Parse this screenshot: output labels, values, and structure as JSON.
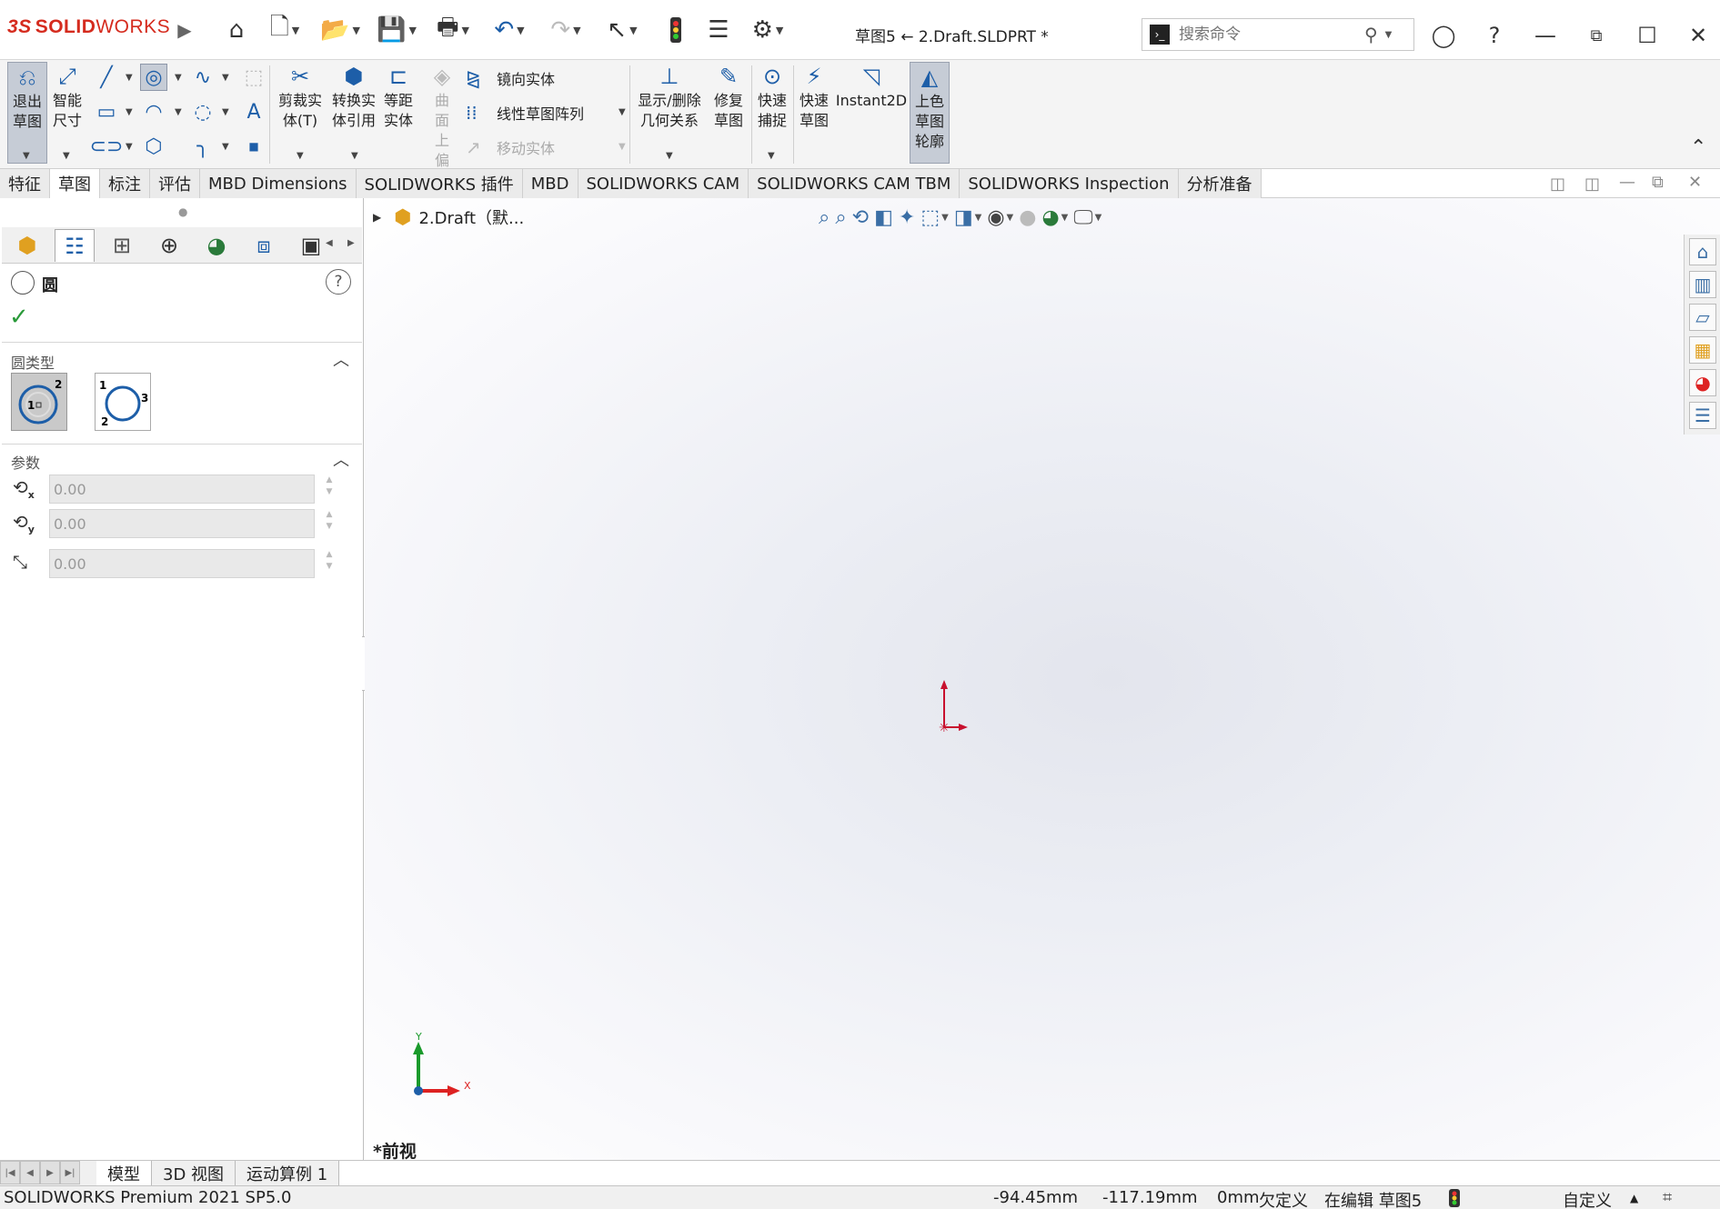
{
  "app": {
    "brand_prefix": "3S",
    "brand_solid": "SOLID",
    "brand_works": "WORKS"
  },
  "window": {
    "title": "草图5 ← 2.Draft.SLDPRT *"
  },
  "search": {
    "placeholder": "搜索命令"
  },
  "colors": {
    "accent": "#1d5ea8",
    "brand": "#d52b1e",
    "origin_red": "#c8102e",
    "axis_green": "#1a9a2b"
  },
  "toolbar": {
    "exit_sketch": "退出草图",
    "smart_dim": "智能尺寸",
    "trim": "剪裁实体(T)",
    "convert": "转换实体引用",
    "offset": "等距实体",
    "surface_offset": "曲面上偏移",
    "mirror": "镜向实体",
    "linear_pattern": "线性草图阵列",
    "move": "移动实体",
    "relations": "显示/删除几何关系",
    "repair": "修复草图",
    "quick_snap": "快速捕捉",
    "rapid_sketch": "快速草图",
    "instant2d": "Instant2D",
    "shaded_contour": "上色草图轮廓"
  },
  "tabs": [
    "特征",
    "草图",
    "标注",
    "评估",
    "MBD Dimensions",
    "SOLIDWORKS 插件",
    "MBD",
    "SOLIDWORKS CAM",
    "SOLIDWORKS CAM TBM",
    "SOLIDWORKS Inspection",
    "分析准备"
  ],
  "tree": {
    "root": "2.Draft（默..."
  },
  "propertyManager": {
    "title": "圆",
    "section_type": "圆类型",
    "section_params": "参数",
    "params": [
      "0.00",
      "0.00",
      "0.00"
    ]
  },
  "graphics": {
    "view_label": "*前视",
    "axis_x": "X",
    "axis_y": "Y"
  },
  "bottom_tabs": [
    "模型",
    "3D 视图",
    "运动算例 1"
  ],
  "status": {
    "product": "SOLIDWORKS Premium 2021 SP5.0",
    "x": "-94.45mm",
    "y": "-117.19mm",
    "z": "0mm",
    "state": "欠定义",
    "editing": "在编辑 草图5",
    "units": "自定义"
  }
}
